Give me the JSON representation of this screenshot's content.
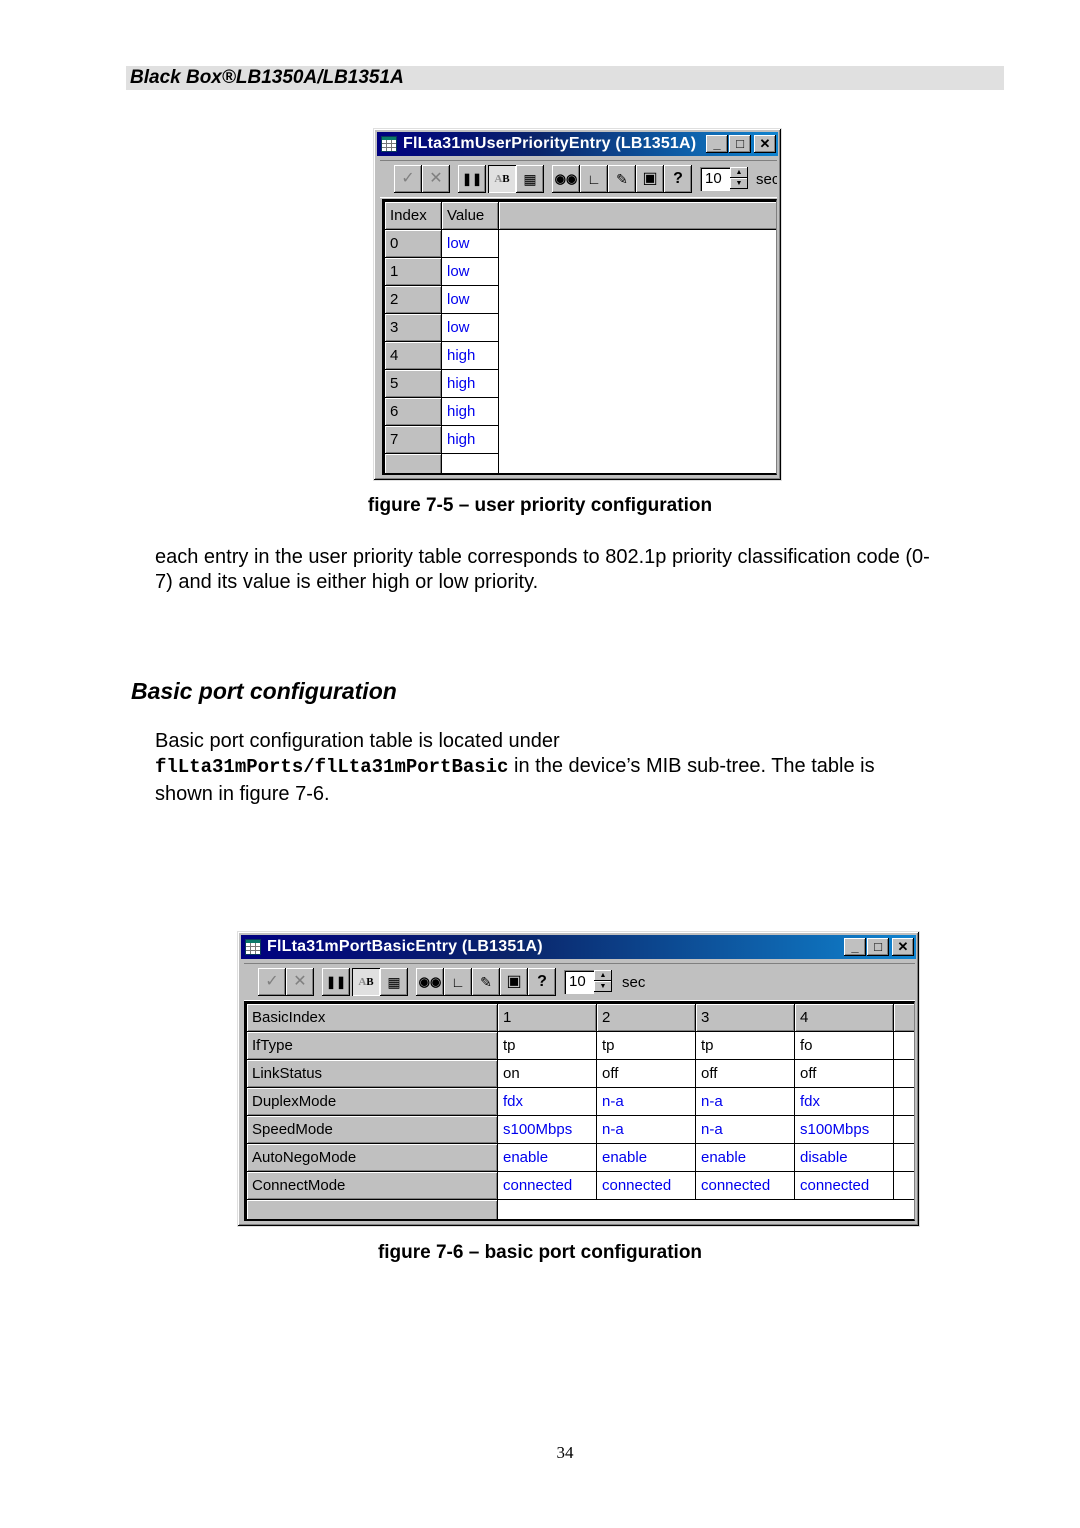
{
  "header": {
    "title": "Black Box®LB1350A/LB1351A"
  },
  "figure1": {
    "window_title": "FlLta31mUserPriorityEntry (LB1351A)",
    "window_buttons": {
      "minimize": "_",
      "maximize": "□",
      "close": "✕"
    },
    "toolbar": {
      "icons": [
        "check-icon",
        "cancel-icon",
        "pause-icon",
        "ab-icon",
        "resize-icon",
        "binoculars-icon",
        "chart-icon",
        "probe-icon",
        "save-icon",
        "help-icon"
      ],
      "refresh_value": "10",
      "refresh_unit": "sec"
    },
    "columns": [
      "Index",
      "Value"
    ],
    "rows": [
      {
        "index": "0",
        "value": "low"
      },
      {
        "index": "1",
        "value": "low"
      },
      {
        "index": "2",
        "value": "low"
      },
      {
        "index": "3",
        "value": "low"
      },
      {
        "index": "4",
        "value": "high"
      },
      {
        "index": "5",
        "value": "high"
      },
      {
        "index": "6",
        "value": "high"
      },
      {
        "index": "7",
        "value": "high"
      }
    ],
    "caption": "figure 7-5 – user priority configuration"
  },
  "paragraph1": "each entry in the user priority table corresponds to 802.1p priority classification code (0-7) and its value is either high or low priority.",
  "paragraph1_line1": "each entry in the user priority table corresponds to 802.1p priority classification code (0-",
  "paragraph1_line2": "7) and its value is either high or low priority.",
  "section": {
    "title": "Basic port configuration",
    "text_line1": "Basic port configuration table is located under",
    "code": "flLta31mPorts/flLta31mPortBasic",
    "text_after_code": " in the device’s MIB sub-tree. The table is",
    "text_line3": "shown in figure 7-6."
  },
  "figure2": {
    "window_title": "FlLta31mPortBasicEntry (LB1351A)",
    "window_buttons": {
      "minimize": "_",
      "maximize": "□",
      "close": "✕"
    },
    "toolbar": {
      "refresh_value": "10",
      "refresh_unit": "sec"
    },
    "rows": [
      {
        "label": "BasicIndex",
        "values": [
          "1",
          "2",
          "3",
          "4"
        ]
      },
      {
        "label": "IfType",
        "values": [
          "tp",
          "tp",
          "tp",
          "fo"
        ]
      },
      {
        "label": "LinkStatus",
        "values": [
          "on",
          "off",
          "off",
          "off"
        ]
      },
      {
        "label": "DuplexMode",
        "values": [
          "fdx",
          "n-a",
          "n-a",
          "fdx"
        ]
      },
      {
        "label": "SpeedMode",
        "values": [
          "s100Mbps",
          "n-a",
          "n-a",
          "s100Mbps"
        ]
      },
      {
        "label": "AutoNegoMode",
        "values": [
          "enable",
          "enable",
          "enable",
          "disable"
        ]
      },
      {
        "label": "ConnectMode",
        "values": [
          "connected",
          "connected",
          "connected",
          "connected"
        ]
      }
    ],
    "caption": "figure 7-6 – basic port configuration"
  },
  "page_number": "34",
  "colors": {
    "editable_value": "#0000ee",
    "title_bar": "#000080",
    "window_face": "#c0c0c0"
  }
}
